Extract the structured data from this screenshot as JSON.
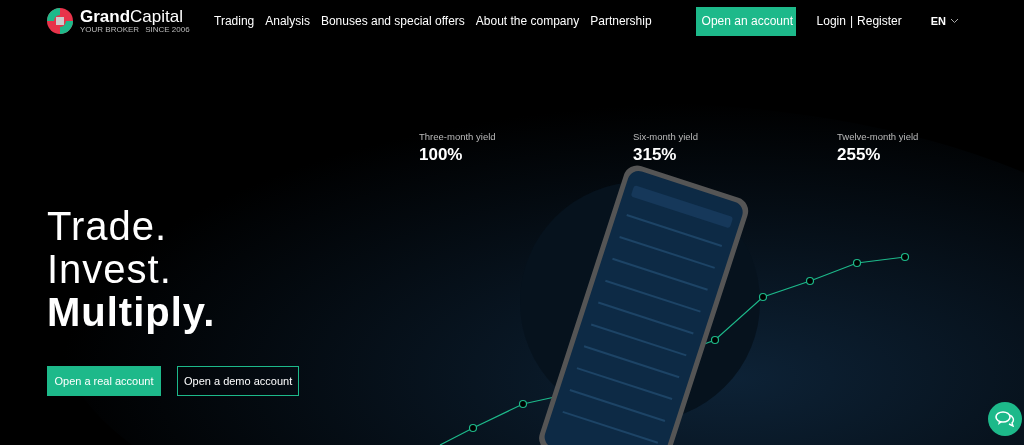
{
  "header": {
    "logo": {
      "name_bold": "Grand",
      "name_light": "Capital",
      "tagline_left": "YOUR BROKER",
      "tagline_right": "SINCE 2006"
    },
    "nav": [
      "Trading",
      "Analysis",
      "Bonuses and special offers",
      "About the company",
      "Partnership"
    ],
    "cta": "Open an account",
    "login": "Login",
    "separator": "|",
    "register": "Register",
    "language": "EN"
  },
  "hero": {
    "stats": [
      {
        "label": "Three-month yield",
        "value": "100%"
      },
      {
        "label": "Six-month yield",
        "value": "315%"
      },
      {
        "label": "Twelve-month yield",
        "value": "255%"
      }
    ],
    "headline": [
      {
        "text": "Trade.",
        "bold": false
      },
      {
        "text": "Invest.",
        "bold": false
      },
      {
        "text": "Multiply.",
        "bold": true
      }
    ],
    "buttons": [
      {
        "label": "Open a real account",
        "kind": "primary"
      },
      {
        "label": "Open a demo account",
        "kind": "outline"
      }
    ]
  }
}
